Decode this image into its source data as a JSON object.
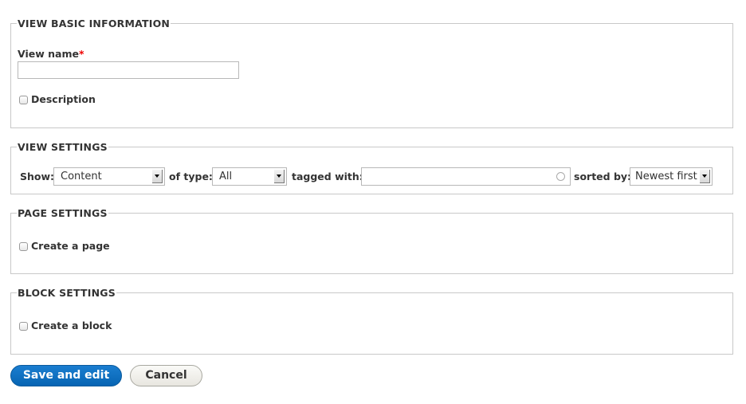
{
  "basic_info": {
    "legend": "VIEW BASIC INFORMATION",
    "view_name_label": "View name",
    "required_marker": "*",
    "view_name_value": "",
    "description_label": "Description",
    "description_checked": false
  },
  "view_settings": {
    "legend": "VIEW SETTINGS",
    "show_label": "Show:",
    "show_value": "Content",
    "type_label": "of type:",
    "type_value": "All",
    "tagged_label": "tagged with:",
    "tagged_value": "",
    "sorted_label": "sorted by:",
    "sorted_value": "Newest first"
  },
  "page_settings": {
    "legend": "PAGE SETTINGS",
    "create_page_label": "Create a page",
    "create_page_checked": false
  },
  "block_settings": {
    "legend": "BLOCK SETTINGS",
    "create_block_label": "Create a block",
    "create_block_checked": false
  },
  "actions": {
    "save_label": "Save and edit",
    "cancel_label": "Cancel"
  },
  "colors": {
    "primary": "#0a6fc2",
    "required": "#ee0000"
  }
}
